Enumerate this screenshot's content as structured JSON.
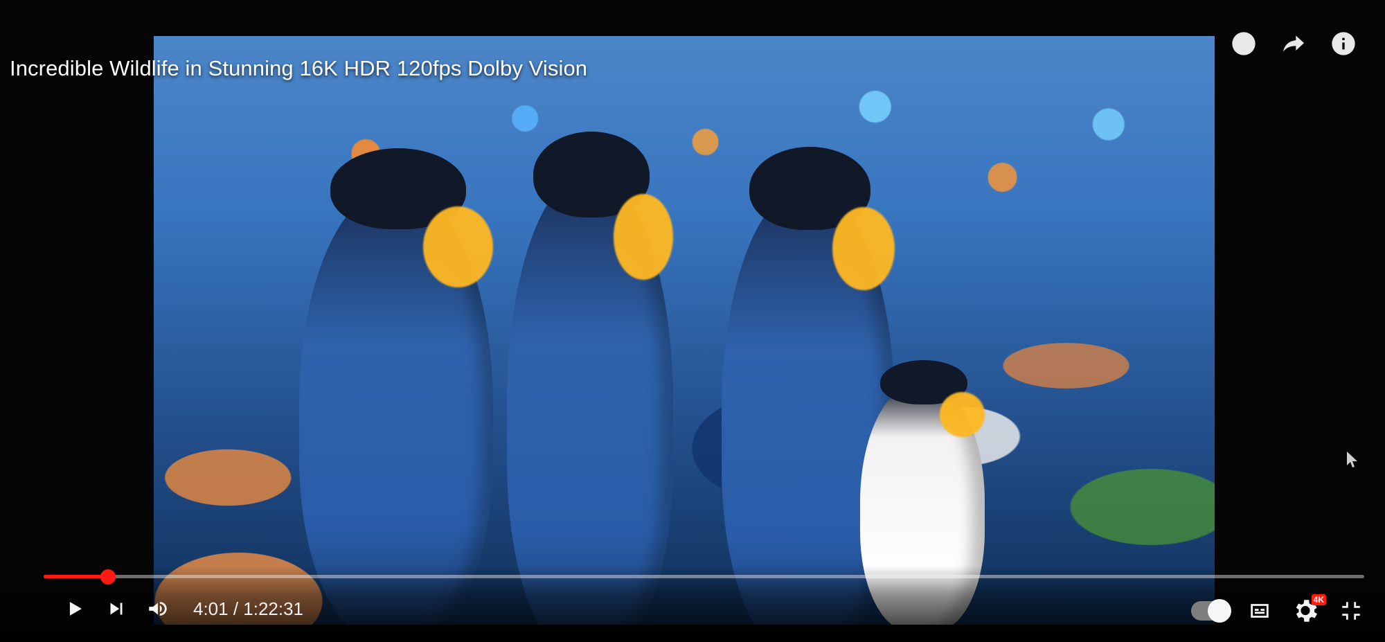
{
  "video": {
    "title": "Incredible Wildlife in Stunning 16K HDR 120fps Dolby Vision"
  },
  "player": {
    "progress_percent": 4.9,
    "current_time": "4:01",
    "duration": "1:22:31",
    "time_display": "4:01 / 1:22:31",
    "quality_badge": "4K"
  },
  "icons": {
    "top": [
      "watch-later-icon",
      "share-icon",
      "info-icon"
    ],
    "bottom_left": [
      "play-icon",
      "next-icon",
      "volume-icon"
    ],
    "bottom_right": [
      "autoplay-toggle",
      "captions-icon",
      "settings-icon",
      "fullscreen-exit-icon"
    ]
  },
  "colors": {
    "accent": "#ff1b12",
    "text": "#ffffff"
  }
}
